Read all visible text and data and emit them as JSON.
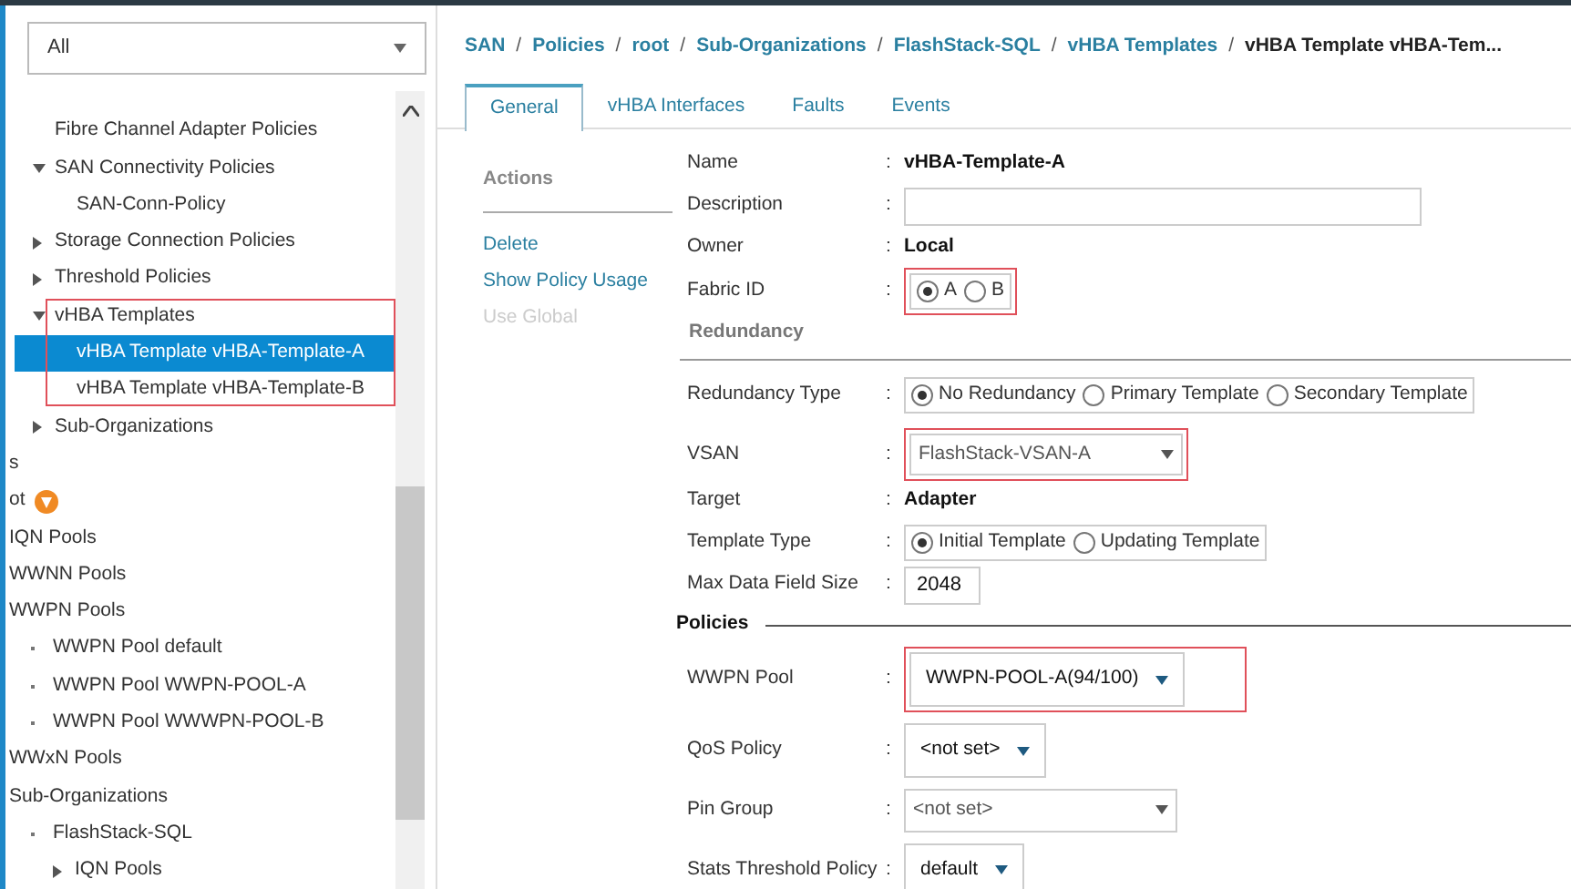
{
  "filter": {
    "value": "All"
  },
  "tree_upper": [
    {
      "label": "Fibre Channel Adapter Policies",
      "kind": "leaf"
    },
    {
      "label": "SAN Connectivity Policies",
      "kind": "node",
      "expanded": true,
      "children": [
        {
          "label": "SAN-Conn-Policy",
          "kind": "leaf"
        }
      ]
    },
    {
      "label": "Storage Connection Policies",
      "kind": "node",
      "expanded": false
    },
    {
      "label": "Threshold Policies",
      "kind": "node",
      "expanded": false
    },
    {
      "label": "vHBA Templates",
      "kind": "node",
      "expanded": true,
      "highlighted": true,
      "children": [
        {
          "label": "vHBA Template vHBA-Template-A",
          "kind": "leaf",
          "selected": true
        },
        {
          "label": "vHBA Template vHBA-Template-B",
          "kind": "leaf",
          "selected": false
        }
      ]
    },
    {
      "label": "Sub-Organizations",
      "kind": "node",
      "expanded": false
    }
  ],
  "tree_lower": [
    {
      "label": "s"
    },
    {
      "label": "ot",
      "warning": true
    },
    {
      "label": "IQN Pools"
    },
    {
      "label": "WWNN Pools"
    },
    {
      "label": "WWPN Pools",
      "children": [
        {
          "label": "WWPN Pool default",
          "kind": "bullet"
        },
        {
          "label": "WWPN Pool WWPN-POOL-A",
          "kind": "bullet"
        },
        {
          "label": "WWPN Pool WWWPN-POOL-B",
          "kind": "bullet"
        }
      ]
    },
    {
      "label": "WWxN Pools"
    },
    {
      "label": "Sub-Organizations",
      "children": [
        {
          "label": "FlashStack-SQL",
          "kind": "bullet",
          "children": [
            {
              "label": "IQN Pools",
              "kind": "node",
              "expanded": false
            }
          ]
        }
      ]
    }
  ],
  "breadcrumb": [
    {
      "label": "SAN"
    },
    {
      "separator": "/",
      "label": "Policies"
    },
    {
      "separator": "/",
      "label": "root"
    },
    {
      "separator": "/",
      "label": "Sub-Organizations"
    },
    {
      "separator": "/",
      "label": "FlashStack-SQL"
    },
    {
      "separator": "/",
      "label": "vHBA Templates"
    },
    {
      "separator": "/",
      "label": "vHBA Template vHBA-Tem..."
    }
  ],
  "tabs": [
    {
      "label": "General",
      "selected": true
    },
    {
      "label": "vHBA Interfaces",
      "selected": false
    },
    {
      "label": "Faults",
      "selected": false
    },
    {
      "label": "Events",
      "selected": false
    }
  ],
  "actions": {
    "title": "Actions",
    "items": [
      {
        "label": "Delete",
        "disabled": false
      },
      {
        "label": "Show Policy Usage",
        "disabled": false
      },
      {
        "label": "Use Global",
        "disabled": true
      }
    ]
  },
  "fields": [
    {
      "kind": "text",
      "label": "Name",
      "colon": ":",
      "value": "vHBA-Template-A"
    },
    {
      "kind": "input",
      "label": "Description",
      "colon": ":"
    },
    {
      "kind": "text",
      "label": "Owner",
      "colon": ":",
      "value": "Local"
    },
    {
      "kind": "radio",
      "label": "Fabric ID",
      "colon": ":",
      "highlighted": true,
      "options": [
        {
          "label": "A",
          "selected": true
        },
        {
          "label": "B",
          "selected": false
        }
      ]
    },
    {
      "kind": "subsection",
      "label": "Redundancy"
    },
    {
      "kind": "radio",
      "label": "Redundancy Type",
      "colon": ":",
      "options": [
        {
          "label": "No Redundancy",
          "selected": true
        },
        {
          "label": "Primary Template",
          "selected": false
        },
        {
          "label": "Secondary Template",
          "selected": false
        }
      ]
    },
    {
      "kind": "combo",
      "label": "VSAN",
      "colon": ":",
      "value": "FlashStack-VSAN-A",
      "highlighted": true
    },
    {
      "kind": "text",
      "label": "Target",
      "colon": ":",
      "value": "Adapter"
    },
    {
      "kind": "radio",
      "label": "Template Type",
      "colon": ":",
      "options": [
        {
          "label": "Initial Template",
          "selected": true
        },
        {
          "label": "Updating Template",
          "selected": false
        }
      ]
    },
    {
      "kind": "input",
      "label": "Max Data Field Size",
      "colon": ":",
      "value": "2048"
    },
    {
      "kind": "section",
      "label": "Policies"
    },
    {
      "kind": "select",
      "label": "WWPN Pool",
      "colon": ":",
      "value": "WWPN-POOL-A(94/100)",
      "highlighted": true
    },
    {
      "kind": "select",
      "label": "QoS Policy",
      "colon": ":",
      "value": "<not set>"
    },
    {
      "kind": "combo",
      "label": "Pin Group",
      "colon": ":",
      "value": "<not set>"
    },
    {
      "kind": "select",
      "label": "Stats Threshold Policy",
      "colon": ":",
      "value": "default"
    }
  ]
}
